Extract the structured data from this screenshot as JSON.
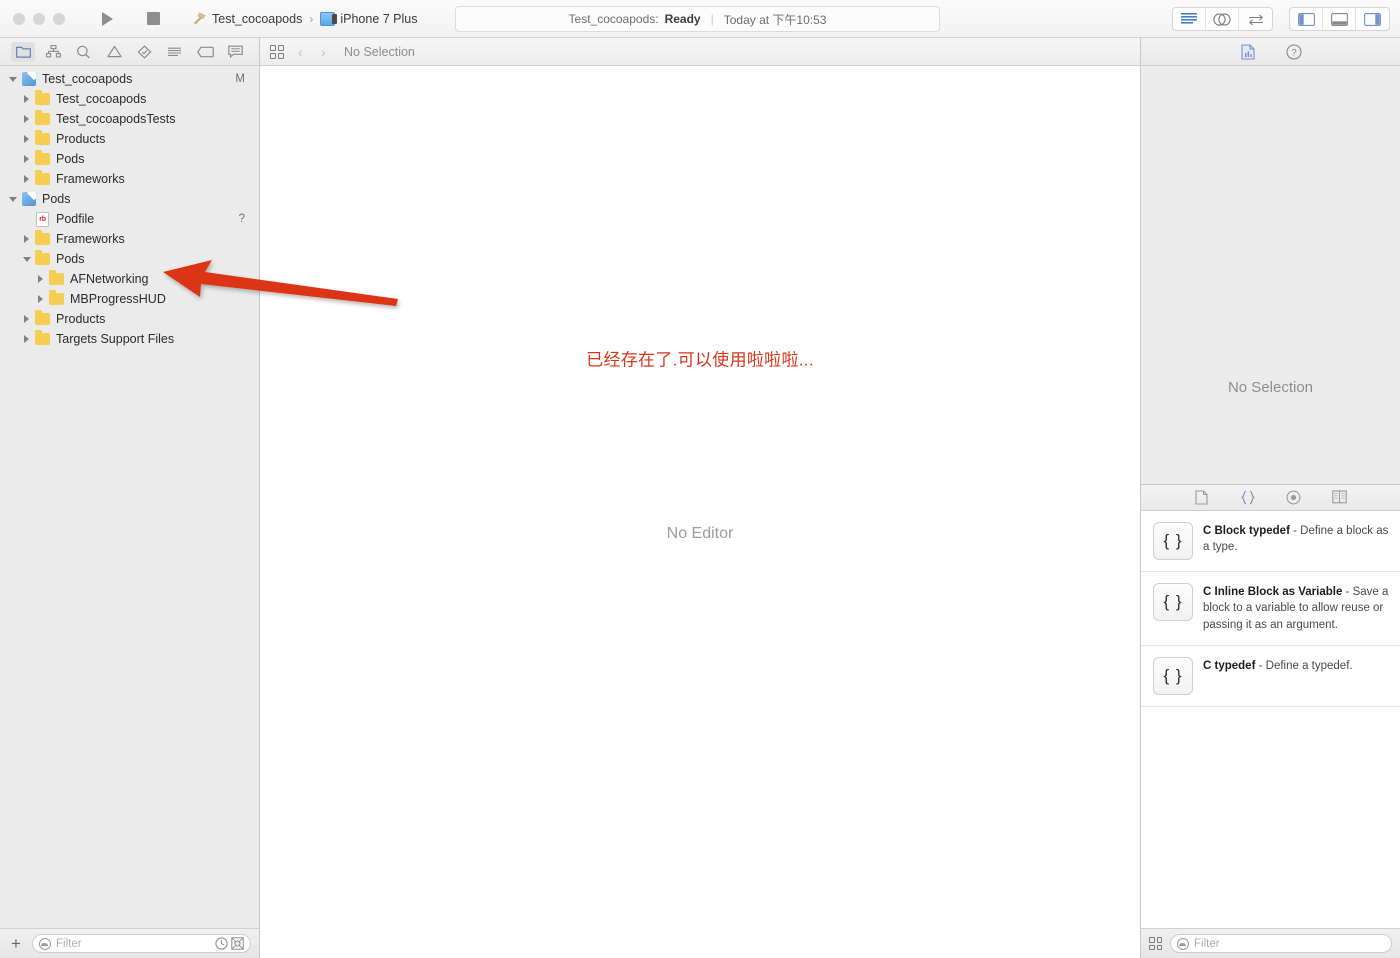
{
  "toolbar": {
    "traffic_lights": [
      "close",
      "minimize",
      "zoom"
    ],
    "run_label": "Run",
    "stop_label": "Stop",
    "scheme_name": "Test_cocoapods",
    "scheme_separator": "›",
    "destination_name": "iPhone 7 Plus",
    "status": {
      "project": "Test_cocoapods:",
      "state": "Ready",
      "separator": "|",
      "time": "Today at 下午10:53"
    },
    "editor_modes": [
      "standard-editor-icon",
      "assistant-editor-icon",
      "version-editor-icon"
    ],
    "view_toggles": [
      "navigator-toggle-icon",
      "debug-area-toggle-icon",
      "utilities-toggle-icon"
    ]
  },
  "navigator": {
    "tabs": [
      {
        "name": "project-navigator",
        "icon": "folder-icon",
        "selected": true
      },
      {
        "name": "symbol-navigator",
        "icon": "hierarchy-icon",
        "selected": false
      },
      {
        "name": "find-navigator",
        "icon": "search-icon",
        "selected": false
      },
      {
        "name": "issue-navigator",
        "icon": "warning-triangle-icon",
        "selected": false
      },
      {
        "name": "test-navigator",
        "icon": "diamond-icon",
        "selected": false
      },
      {
        "name": "debug-navigator",
        "icon": "debug-spray-icon",
        "selected": false
      },
      {
        "name": "breakpoint-navigator",
        "icon": "breakpoint-tag-icon",
        "selected": false
      },
      {
        "name": "report-navigator",
        "icon": "speech-bubble-icon",
        "selected": false
      }
    ],
    "tree": [
      {
        "label": "Test_cocoapods",
        "depth": 0,
        "icon": "project",
        "state": "open",
        "badge": "M"
      },
      {
        "label": "Test_cocoapods",
        "depth": 1,
        "icon": "folder",
        "state": "closed",
        "badge": ""
      },
      {
        "label": "Test_cocoapodsTests",
        "depth": 1,
        "icon": "folder",
        "state": "closed",
        "badge": ""
      },
      {
        "label": "Products",
        "depth": 1,
        "icon": "folder",
        "state": "closed",
        "badge": ""
      },
      {
        "label": "Pods",
        "depth": 1,
        "icon": "folder",
        "state": "closed",
        "badge": ""
      },
      {
        "label": "Frameworks",
        "depth": 1,
        "icon": "folder",
        "state": "closed",
        "badge": ""
      },
      {
        "label": "Pods",
        "depth": 0,
        "icon": "project",
        "state": "open",
        "badge": ""
      },
      {
        "label": "Podfile",
        "depth": 1,
        "icon": "ruby",
        "state": "leaf",
        "badge": "?"
      },
      {
        "label": "Frameworks",
        "depth": 1,
        "icon": "folder",
        "state": "closed",
        "badge": ""
      },
      {
        "label": "Pods",
        "depth": 1,
        "icon": "folder",
        "state": "open",
        "badge": ""
      },
      {
        "label": "AFNetworking",
        "depth": 2,
        "icon": "folder",
        "state": "closed",
        "badge": ""
      },
      {
        "label": "MBProgressHUD",
        "depth": 2,
        "icon": "folder",
        "state": "closed",
        "badge": ""
      },
      {
        "label": "Products",
        "depth": 1,
        "icon": "folder",
        "state": "closed",
        "badge": ""
      },
      {
        "label": "Targets Support Files",
        "depth": 1,
        "icon": "folder",
        "state": "closed",
        "badge": ""
      }
    ],
    "footer": {
      "add_label": "+",
      "filter_placeholder": "Filter",
      "recent_icon": "clock-icon",
      "source_control_icon": "source-control-filter-icon"
    }
  },
  "editor": {
    "jumpbar": {
      "related_items_icon": "related-items-grid-icon",
      "back_label": "‹",
      "forward_label": "›",
      "title": "No Selection"
    },
    "placeholder": "No Editor",
    "annotation": {
      "text": "已经存在了.可以使用啦啦啦...",
      "color": "#d8361b",
      "arrow_color": "#dc3412"
    }
  },
  "utilities": {
    "inspector_tabs": [
      {
        "name": "file-inspector",
        "icon": "document-icon",
        "selected": true
      },
      {
        "name": "quick-help-inspector",
        "icon": "question-circle-icon",
        "selected": false
      }
    ],
    "inspector_placeholder": "No Selection",
    "library_tabs": [
      {
        "name": "file-template-library",
        "icon": "document-icon",
        "selected": false
      },
      {
        "name": "code-snippet-library",
        "icon": "braces-icon",
        "selected": true
      },
      {
        "name": "object-library",
        "icon": "circle-target-icon",
        "selected": false
      },
      {
        "name": "media-library",
        "icon": "media-icon",
        "selected": false
      }
    ],
    "snippets": [
      {
        "icon_label": "{ }",
        "title": "C Block typedef",
        "dash": " - ",
        "description": "Define a block as a type."
      },
      {
        "icon_label": "{ }",
        "title": "C Inline Block as Variable",
        "dash": " - ",
        "description": "Save a block to a variable to allow reuse or passing it as an argument."
      },
      {
        "icon_label": "{ }",
        "title": "C typedef",
        "dash": " - ",
        "description": "Define a typedef."
      }
    ],
    "footer": {
      "layout_icon": "grid-layout-icon",
      "filter_placeholder": "Filter"
    }
  }
}
